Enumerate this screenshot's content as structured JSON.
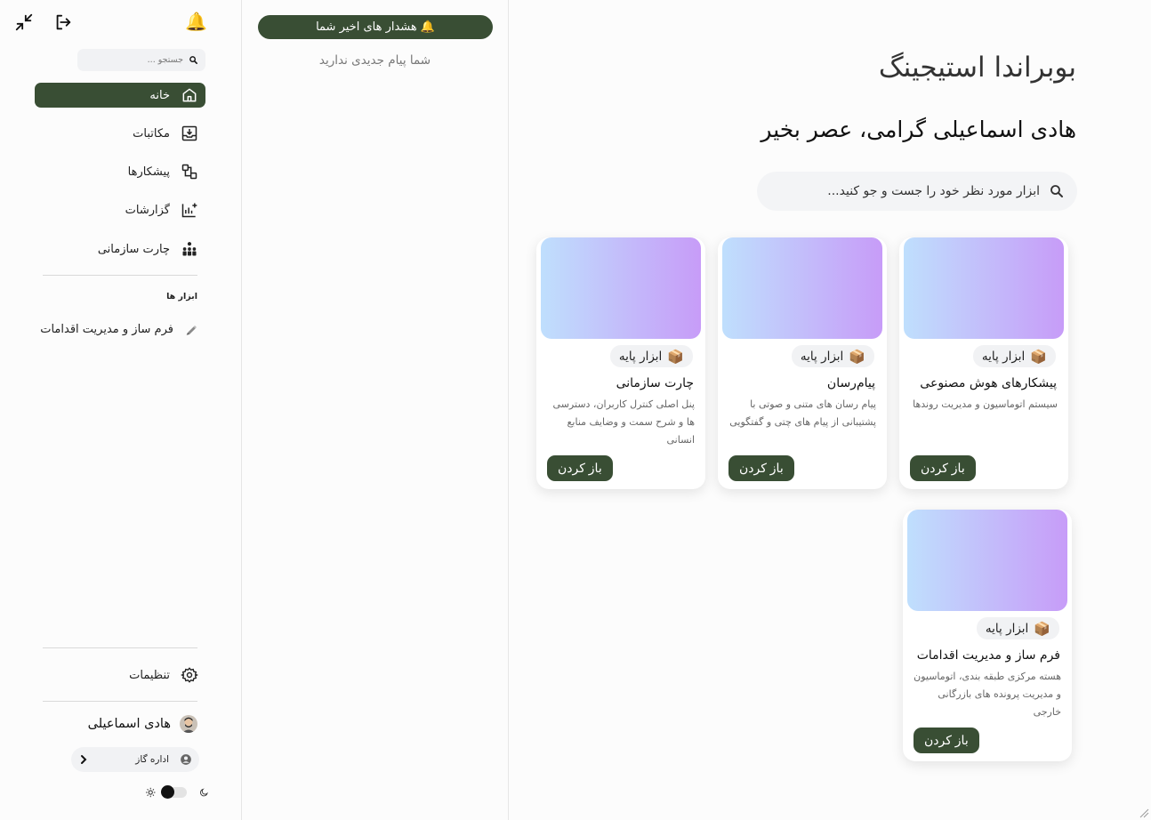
{
  "main": {
    "org_title": "بوبراندا استیجینگ",
    "greeting": "هادی اسماعیلی گرامی، عصر بخیر",
    "search_placeholder": "ابزار مورد نظر خود را جست و جو کنید...",
    "cards": [
      {
        "badge": "ابزار پایه",
        "name": "پیشکارهای هوش مصنوعی",
        "desc": "سیستم اتوماسیون و مدیریت روندها",
        "button": "باز کردن"
      },
      {
        "badge": "ابزار پایه",
        "name": "پیام‌رسان",
        "desc": "پیام رسان های متنی و صوتی با پشتیبانی از پیام های چتی و گفتگویی",
        "button": "باز کردن"
      },
      {
        "badge": "ابزار پایه",
        "name": "چارت سازمانی",
        "desc": "پنل اصلی کنترل کاربران، دسترسی ها و شرح سمت و وضایف منابع انسانی",
        "button": "باز کردن"
      },
      {
        "badge": "ابزار پایه",
        "name": "فرم ساز و مدیریت اقدامات",
        "desc": "هسته مرکزی طبقه بندی، اتوماسیون و مدیریت پرونده های بازرگانی خارجی",
        "button": "باز کردن"
      }
    ]
  },
  "notifications": {
    "title": "هشدار های اخیر شما",
    "empty_text": "شما پیام جدیدی ندارید"
  },
  "sidebar": {
    "search_placeholder": "جستجو ...",
    "nav": [
      {
        "label": "خانه",
        "icon": "home-icon"
      },
      {
        "label": "مکاتبات",
        "icon": "inbox-icon"
      },
      {
        "label": "پیشکارها",
        "icon": "workflow-icon"
      },
      {
        "label": "گزارشات",
        "icon": "chart-add-icon"
      },
      {
        "label": "چارت سازمانی",
        "icon": "org-chart-icon"
      }
    ],
    "tools_section": "ابزار ها",
    "tools": [
      {
        "label": "فرم ساز و مدیریت اقدامات",
        "icon": "pen-icon"
      }
    ],
    "settings_label": "تنظیمات",
    "user_name": "هادی اسماعیلی",
    "department": "اداره گاز"
  },
  "colors": {
    "accent": "#394e34",
    "card_gradient_start": "#bfdffd",
    "card_gradient_end": "#c79cf8"
  }
}
